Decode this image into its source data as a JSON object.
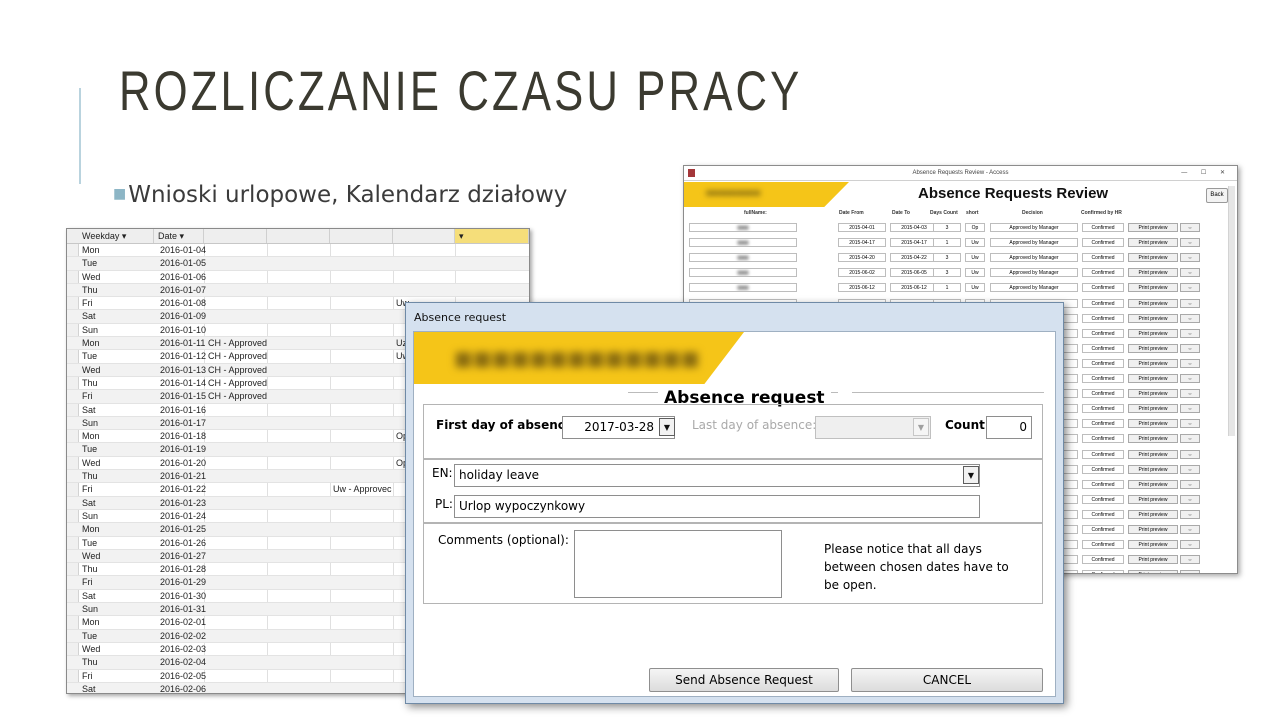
{
  "slide": {
    "title": "ROZLICZANIE CZASU PRACY",
    "bullet": "Wnioski urlopowe, Kalendarz działowy"
  },
  "calendar": {
    "headers": [
      "Weekday",
      "Date",
      "",
      "",
      "",
      "",
      ""
    ],
    "rows": [
      {
        "weekday": "Mon",
        "date": "2016-01-04",
        "status": "",
        "c4": "",
        "c6": ""
      },
      {
        "weekday": "Tue",
        "date": "2016-01-05",
        "status": "",
        "c4": "",
        "c6": ""
      },
      {
        "weekday": "Wed",
        "date": "2016-01-06",
        "status": "",
        "c4": "",
        "c6": ""
      },
      {
        "weekday": "Thu",
        "date": "2016-01-07",
        "status": "",
        "c4": "",
        "c6": ""
      },
      {
        "weekday": "Fri",
        "date": "2016-01-08",
        "status": "",
        "c4": "",
        "c6": "Uw"
      },
      {
        "weekday": "Sat",
        "date": "2016-01-09",
        "status": "",
        "c4": "",
        "c6": ""
      },
      {
        "weekday": "Sun",
        "date": "2016-01-10",
        "status": "",
        "c4": "",
        "c6": ""
      },
      {
        "weekday": "Mon",
        "date": "2016-01-11",
        "status": "CH - Approved",
        "c4": "",
        "c6": "Uz"
      },
      {
        "weekday": "Tue",
        "date": "2016-01-12",
        "status": "CH - Approved",
        "c4": "",
        "c6": "Uw"
      },
      {
        "weekday": "Wed",
        "date": "2016-01-13",
        "status": "CH - Approved",
        "c4": "",
        "c6": ""
      },
      {
        "weekday": "Thu",
        "date": "2016-01-14",
        "status": "CH - Approved",
        "c4": "",
        "c6": ""
      },
      {
        "weekday": "Fri",
        "date": "2016-01-15",
        "status": "CH - Approved",
        "c4": "",
        "c6": ""
      },
      {
        "weekday": "Sat",
        "date": "2016-01-16",
        "status": "",
        "c4": "",
        "c6": ""
      },
      {
        "weekday": "Sun",
        "date": "2016-01-17",
        "status": "",
        "c4": "",
        "c6": ""
      },
      {
        "weekday": "Mon",
        "date": "2016-01-18",
        "status": "",
        "c4": "",
        "c6": "Op"
      },
      {
        "weekday": "Tue",
        "date": "2016-01-19",
        "status": "",
        "c4": "",
        "c6": ""
      },
      {
        "weekday": "Wed",
        "date": "2016-01-20",
        "status": "",
        "c4": "",
        "c6": "Op"
      },
      {
        "weekday": "Thu",
        "date": "2016-01-21",
        "status": "",
        "c4": "",
        "c6": ""
      },
      {
        "weekday": "Fri",
        "date": "2016-01-22",
        "status": "",
        "c4": "Uw - Approvec",
        "c6": ""
      },
      {
        "weekday": "Sat",
        "date": "2016-01-23",
        "status": "",
        "c4": "",
        "c6": ""
      },
      {
        "weekday": "Sun",
        "date": "2016-01-24",
        "status": "",
        "c4": "",
        "c6": ""
      },
      {
        "weekday": "Mon",
        "date": "2016-01-25",
        "status": "",
        "c4": "",
        "c6": ""
      },
      {
        "weekday": "Tue",
        "date": "2016-01-26",
        "status": "",
        "c4": "",
        "c6": ""
      },
      {
        "weekday": "Wed",
        "date": "2016-01-27",
        "status": "",
        "c4": "",
        "c6": ""
      },
      {
        "weekday": "Thu",
        "date": "2016-01-28",
        "status": "",
        "c4": "",
        "c6": ""
      },
      {
        "weekday": "Fri",
        "date": "2016-01-29",
        "status": "",
        "c4": "",
        "c6": ""
      },
      {
        "weekday": "Sat",
        "date": "2016-01-30",
        "status": "",
        "c4": "",
        "c6": ""
      },
      {
        "weekday": "Sun",
        "date": "2016-01-31",
        "status": "",
        "c4": "",
        "c6": ""
      },
      {
        "weekday": "Mon",
        "date": "2016-02-01",
        "status": "",
        "c4": "",
        "c6": ""
      },
      {
        "weekday": "Tue",
        "date": "2016-02-02",
        "status": "",
        "c4": "",
        "c6": ""
      },
      {
        "weekday": "Wed",
        "date": "2016-02-03",
        "status": "",
        "c4": "",
        "c6": ""
      },
      {
        "weekday": "Thu",
        "date": "2016-02-04",
        "status": "",
        "c4": "",
        "c6": ""
      },
      {
        "weekday": "Fri",
        "date": "2016-02-05",
        "status": "",
        "c4": "",
        "c6": ""
      },
      {
        "weekday": "Sat",
        "date": "2016-02-06",
        "status": "",
        "c4": "",
        "c6": ""
      }
    ]
  },
  "review": {
    "window_title": "Absence Requests Review - Access",
    "window_controls": "— ☐ ✕",
    "heading": "Absence Requests Review",
    "back_label": "Back",
    "columns": [
      "fullName:",
      "Date From",
      "Date To",
      "Days Count",
      "short",
      "Decision",
      "Confirmed by HR"
    ],
    "rows": [
      {
        "from": "2015-04-01",
        "to": "2015-04-03",
        "days": "3",
        "short": "Op",
        "decision": "Approved by Manager",
        "hr": "Confirmed",
        "btn": "Print preview"
      },
      {
        "from": "2015-04-17",
        "to": "2015-04-17",
        "days": "1",
        "short": "Uw",
        "decision": "Approved by Manager",
        "hr": "Confirmed",
        "btn": "Print preview"
      },
      {
        "from": "2015-04-20",
        "to": "2015-04-22",
        "days": "3",
        "short": "Uw",
        "decision": "Approved by Manager",
        "hr": "Confirmed",
        "btn": "Print preview"
      },
      {
        "from": "2015-06-02",
        "to": "2015-06-05",
        "days": "3",
        "short": "Uw",
        "decision": "Approved by Manager",
        "hr": "Confirmed",
        "btn": "Print preview"
      },
      {
        "from": "2015-06-12",
        "to": "2015-06-12",
        "days": "1",
        "short": "Uw",
        "decision": "Approved by Manager",
        "hr": "Confirmed",
        "btn": "Print preview"
      },
      {
        "from": "",
        "to": "",
        "days": "",
        "short": "",
        "decision": "",
        "hr": "Confirmed",
        "btn": "Print preview"
      },
      {
        "from": "",
        "to": "",
        "days": "",
        "short": "",
        "decision": "",
        "hr": "Confirmed",
        "btn": "Print preview"
      },
      {
        "from": "",
        "to": "",
        "days": "",
        "short": "",
        "decision": "",
        "hr": "Confirmed",
        "btn": "Print preview"
      },
      {
        "from": "",
        "to": "",
        "days": "",
        "short": "",
        "decision": "",
        "hr": "Confirmed",
        "btn": "Print preview"
      },
      {
        "from": "",
        "to": "",
        "days": "",
        "short": "",
        "decision": "",
        "hr": "Confirmed",
        "btn": "Print preview"
      },
      {
        "from": "",
        "to": "",
        "days": "",
        "short": "",
        "decision": "",
        "hr": "Confirmed",
        "btn": "Print preview"
      },
      {
        "from": "",
        "to": "",
        "days": "",
        "short": "",
        "decision": "",
        "hr": "Confirmed",
        "btn": "Print preview"
      },
      {
        "from": "",
        "to": "",
        "days": "",
        "short": "",
        "decision": "",
        "hr": "Confirmed",
        "btn": "Print preview"
      },
      {
        "from": "",
        "to": "",
        "days": "",
        "short": "",
        "decision": "",
        "hr": "Confirmed",
        "btn": "Print preview"
      },
      {
        "from": "",
        "to": "",
        "days": "",
        "short": "",
        "decision": "",
        "hr": "Confirmed",
        "btn": "Print preview"
      },
      {
        "from": "",
        "to": "",
        "days": "",
        "short": "",
        "decision": "",
        "hr": "Confirmed",
        "btn": "Print preview"
      },
      {
        "from": "",
        "to": "",
        "days": "",
        "short": "",
        "decision": "",
        "hr": "Confirmed",
        "btn": "Print preview"
      },
      {
        "from": "",
        "to": "",
        "days": "",
        "short": "",
        "decision": "",
        "hr": "Confirmed",
        "btn": "Print preview"
      },
      {
        "from": "",
        "to": "",
        "days": "",
        "short": "",
        "decision": "",
        "hr": "Confirmed",
        "btn": "Print preview"
      },
      {
        "from": "",
        "to": "",
        "days": "",
        "short": "",
        "decision": "",
        "hr": "Confirmed",
        "btn": "Print preview"
      },
      {
        "from": "",
        "to": "",
        "days": "",
        "short": "",
        "decision": "",
        "hr": "Confirmed",
        "btn": "Print preview"
      },
      {
        "from": "",
        "to": "",
        "days": "",
        "short": "",
        "decision": "",
        "hr": "Confirmed",
        "btn": "Print preview"
      },
      {
        "from": "",
        "to": "",
        "days": "",
        "short": "",
        "decision": "",
        "hr": "Confirmed",
        "btn": "Print preview"
      },
      {
        "from": "",
        "to": "",
        "days": "",
        "short": "",
        "decision": "",
        "hr": "Confirmed",
        "btn": "Print preview"
      },
      {
        "from": "",
        "to": "",
        "days": "",
        "short": "",
        "decision": "",
        "hr": "Confirmed",
        "btn": "Print preview"
      }
    ]
  },
  "dialog": {
    "window_title": "Absence request",
    "heading": "Absence request",
    "first_day_label": "First day of absence:",
    "first_day_value": "2017-03-28",
    "last_day_label": "Last day of absence:",
    "last_day_value": "",
    "count_label": "Count:",
    "count_value": "0",
    "en_label": "EN:",
    "en_value": "holiday leave",
    "pl_label": "PL:",
    "pl_value": "Urlop wypoczynkowy",
    "comments_label": "Comments (optional):",
    "comments_value": "",
    "note": "Please notice that all days between chosen dates have to be open.",
    "send_label": "Send Absence Request",
    "cancel_label": "CANCEL",
    "dropdown_glyph": "▼",
    "accent_color": "#f5c518"
  }
}
